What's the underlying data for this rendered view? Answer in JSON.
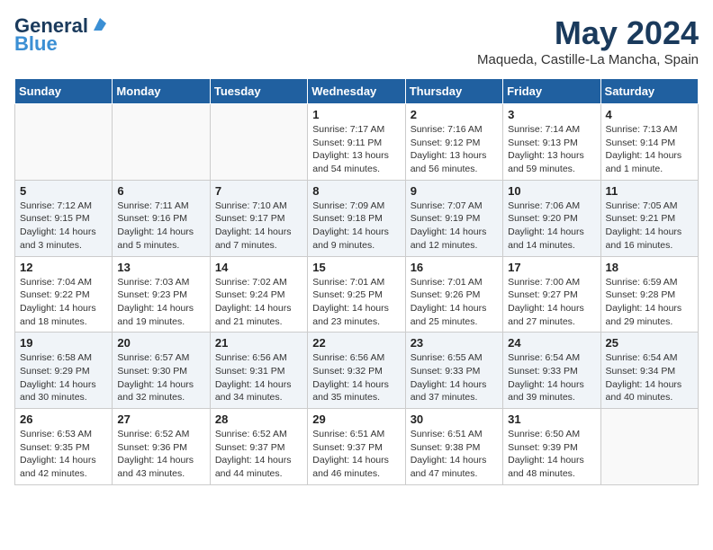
{
  "logo": {
    "line1": "General",
    "line2": "Blue"
  },
  "title": "May 2024",
  "location": "Maqueda, Castille-La Mancha, Spain",
  "days": [
    "Sunday",
    "Monday",
    "Tuesday",
    "Wednesday",
    "Thursday",
    "Friday",
    "Saturday"
  ],
  "weeks": [
    [
      {
        "num": "",
        "info": ""
      },
      {
        "num": "",
        "info": ""
      },
      {
        "num": "",
        "info": ""
      },
      {
        "num": "1",
        "info": "Sunrise: 7:17 AM\nSunset: 9:11 PM\nDaylight: 13 hours\nand 54 minutes."
      },
      {
        "num": "2",
        "info": "Sunrise: 7:16 AM\nSunset: 9:12 PM\nDaylight: 13 hours\nand 56 minutes."
      },
      {
        "num": "3",
        "info": "Sunrise: 7:14 AM\nSunset: 9:13 PM\nDaylight: 13 hours\nand 59 minutes."
      },
      {
        "num": "4",
        "info": "Sunrise: 7:13 AM\nSunset: 9:14 PM\nDaylight: 14 hours\nand 1 minute."
      }
    ],
    [
      {
        "num": "5",
        "info": "Sunrise: 7:12 AM\nSunset: 9:15 PM\nDaylight: 14 hours\nand 3 minutes."
      },
      {
        "num": "6",
        "info": "Sunrise: 7:11 AM\nSunset: 9:16 PM\nDaylight: 14 hours\nand 5 minutes."
      },
      {
        "num": "7",
        "info": "Sunrise: 7:10 AM\nSunset: 9:17 PM\nDaylight: 14 hours\nand 7 minutes."
      },
      {
        "num": "8",
        "info": "Sunrise: 7:09 AM\nSunset: 9:18 PM\nDaylight: 14 hours\nand 9 minutes."
      },
      {
        "num": "9",
        "info": "Sunrise: 7:07 AM\nSunset: 9:19 PM\nDaylight: 14 hours\nand 12 minutes."
      },
      {
        "num": "10",
        "info": "Sunrise: 7:06 AM\nSunset: 9:20 PM\nDaylight: 14 hours\nand 14 minutes."
      },
      {
        "num": "11",
        "info": "Sunrise: 7:05 AM\nSunset: 9:21 PM\nDaylight: 14 hours\nand 16 minutes."
      }
    ],
    [
      {
        "num": "12",
        "info": "Sunrise: 7:04 AM\nSunset: 9:22 PM\nDaylight: 14 hours\nand 18 minutes."
      },
      {
        "num": "13",
        "info": "Sunrise: 7:03 AM\nSunset: 9:23 PM\nDaylight: 14 hours\nand 19 minutes."
      },
      {
        "num": "14",
        "info": "Sunrise: 7:02 AM\nSunset: 9:24 PM\nDaylight: 14 hours\nand 21 minutes."
      },
      {
        "num": "15",
        "info": "Sunrise: 7:01 AM\nSunset: 9:25 PM\nDaylight: 14 hours\nand 23 minutes."
      },
      {
        "num": "16",
        "info": "Sunrise: 7:01 AM\nSunset: 9:26 PM\nDaylight: 14 hours\nand 25 minutes."
      },
      {
        "num": "17",
        "info": "Sunrise: 7:00 AM\nSunset: 9:27 PM\nDaylight: 14 hours\nand 27 minutes."
      },
      {
        "num": "18",
        "info": "Sunrise: 6:59 AM\nSunset: 9:28 PM\nDaylight: 14 hours\nand 29 minutes."
      }
    ],
    [
      {
        "num": "19",
        "info": "Sunrise: 6:58 AM\nSunset: 9:29 PM\nDaylight: 14 hours\nand 30 minutes."
      },
      {
        "num": "20",
        "info": "Sunrise: 6:57 AM\nSunset: 9:30 PM\nDaylight: 14 hours\nand 32 minutes."
      },
      {
        "num": "21",
        "info": "Sunrise: 6:56 AM\nSunset: 9:31 PM\nDaylight: 14 hours\nand 34 minutes."
      },
      {
        "num": "22",
        "info": "Sunrise: 6:56 AM\nSunset: 9:32 PM\nDaylight: 14 hours\nand 35 minutes."
      },
      {
        "num": "23",
        "info": "Sunrise: 6:55 AM\nSunset: 9:33 PM\nDaylight: 14 hours\nand 37 minutes."
      },
      {
        "num": "24",
        "info": "Sunrise: 6:54 AM\nSunset: 9:33 PM\nDaylight: 14 hours\nand 39 minutes."
      },
      {
        "num": "25",
        "info": "Sunrise: 6:54 AM\nSunset: 9:34 PM\nDaylight: 14 hours\nand 40 minutes."
      }
    ],
    [
      {
        "num": "26",
        "info": "Sunrise: 6:53 AM\nSunset: 9:35 PM\nDaylight: 14 hours\nand 42 minutes."
      },
      {
        "num": "27",
        "info": "Sunrise: 6:52 AM\nSunset: 9:36 PM\nDaylight: 14 hours\nand 43 minutes."
      },
      {
        "num": "28",
        "info": "Sunrise: 6:52 AM\nSunset: 9:37 PM\nDaylight: 14 hours\nand 44 minutes."
      },
      {
        "num": "29",
        "info": "Sunrise: 6:51 AM\nSunset: 9:37 PM\nDaylight: 14 hours\nand 46 minutes."
      },
      {
        "num": "30",
        "info": "Sunrise: 6:51 AM\nSunset: 9:38 PM\nDaylight: 14 hours\nand 47 minutes."
      },
      {
        "num": "31",
        "info": "Sunrise: 6:50 AM\nSunset: 9:39 PM\nDaylight: 14 hours\nand 48 minutes."
      },
      {
        "num": "",
        "info": ""
      }
    ]
  ]
}
